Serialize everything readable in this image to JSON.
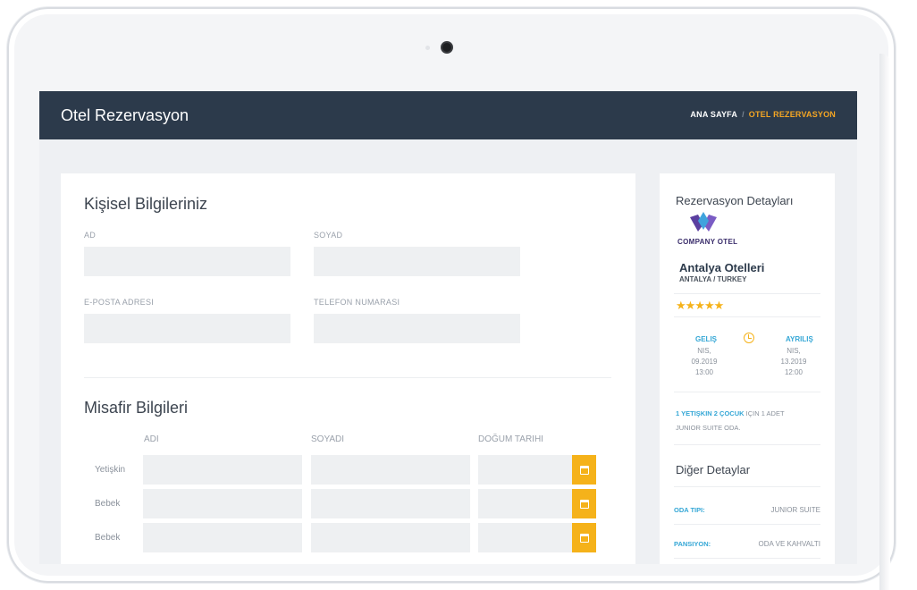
{
  "header": {
    "title": "Otel Rezervasyon",
    "breadcrumb_home": "ANA SAYFA",
    "breadcrumb_separator": "/",
    "breadcrumb_current": "OTEL REZERVASYON"
  },
  "personal": {
    "section_title": "Kişisel Bilgileriniz",
    "first_name_label": "AD",
    "last_name_label": "SOYAD",
    "email_label": "E-POSTA ADRESI",
    "phone_label": "TELEFON NUMARASI"
  },
  "guests": {
    "section_title": "Misafir Bilgileri",
    "columns": [
      "ADI",
      "SOYADI",
      "DOĞUM TARIHI"
    ],
    "rows": [
      "Yetişkin",
      "Bebek",
      "Bebek"
    ]
  },
  "reservation": {
    "title": "Rezervasyon Detayları",
    "logo_text": "COMPANY OTEL",
    "hotel_name": "Antalya Otelleri",
    "hotel_location": "ANTALYA / TURKEY",
    "stars": "★★★★★",
    "star_count": 5,
    "checkin_label": "GELIŞ",
    "checkin_month": "NIS,",
    "checkin_date": "09.2019",
    "checkin_time": "13:00",
    "checkout_label": "AYRILIŞ",
    "checkout_month": "NIS,",
    "checkout_date": "13.2019",
    "checkout_time": "12:00",
    "guests_link": "1 YETIŞKIN 2 ÇOCUK",
    "guests_text": " IÇIN 1 ADET",
    "room_text": "JUNIOR SUITE ODA."
  },
  "other_details": {
    "title": "Diğer Detaylar",
    "room_type_label": "ODA TIPI:",
    "room_type_value": "JUNIOR SUITE",
    "board_label": "PANSIYON:",
    "board_value": "ODA VE KAHVALTI"
  },
  "colors": {
    "header_bg": "#2c3a4b",
    "accent": "#f5a623",
    "link": "#35a7d6",
    "calendar_button": "#f5b21a"
  }
}
